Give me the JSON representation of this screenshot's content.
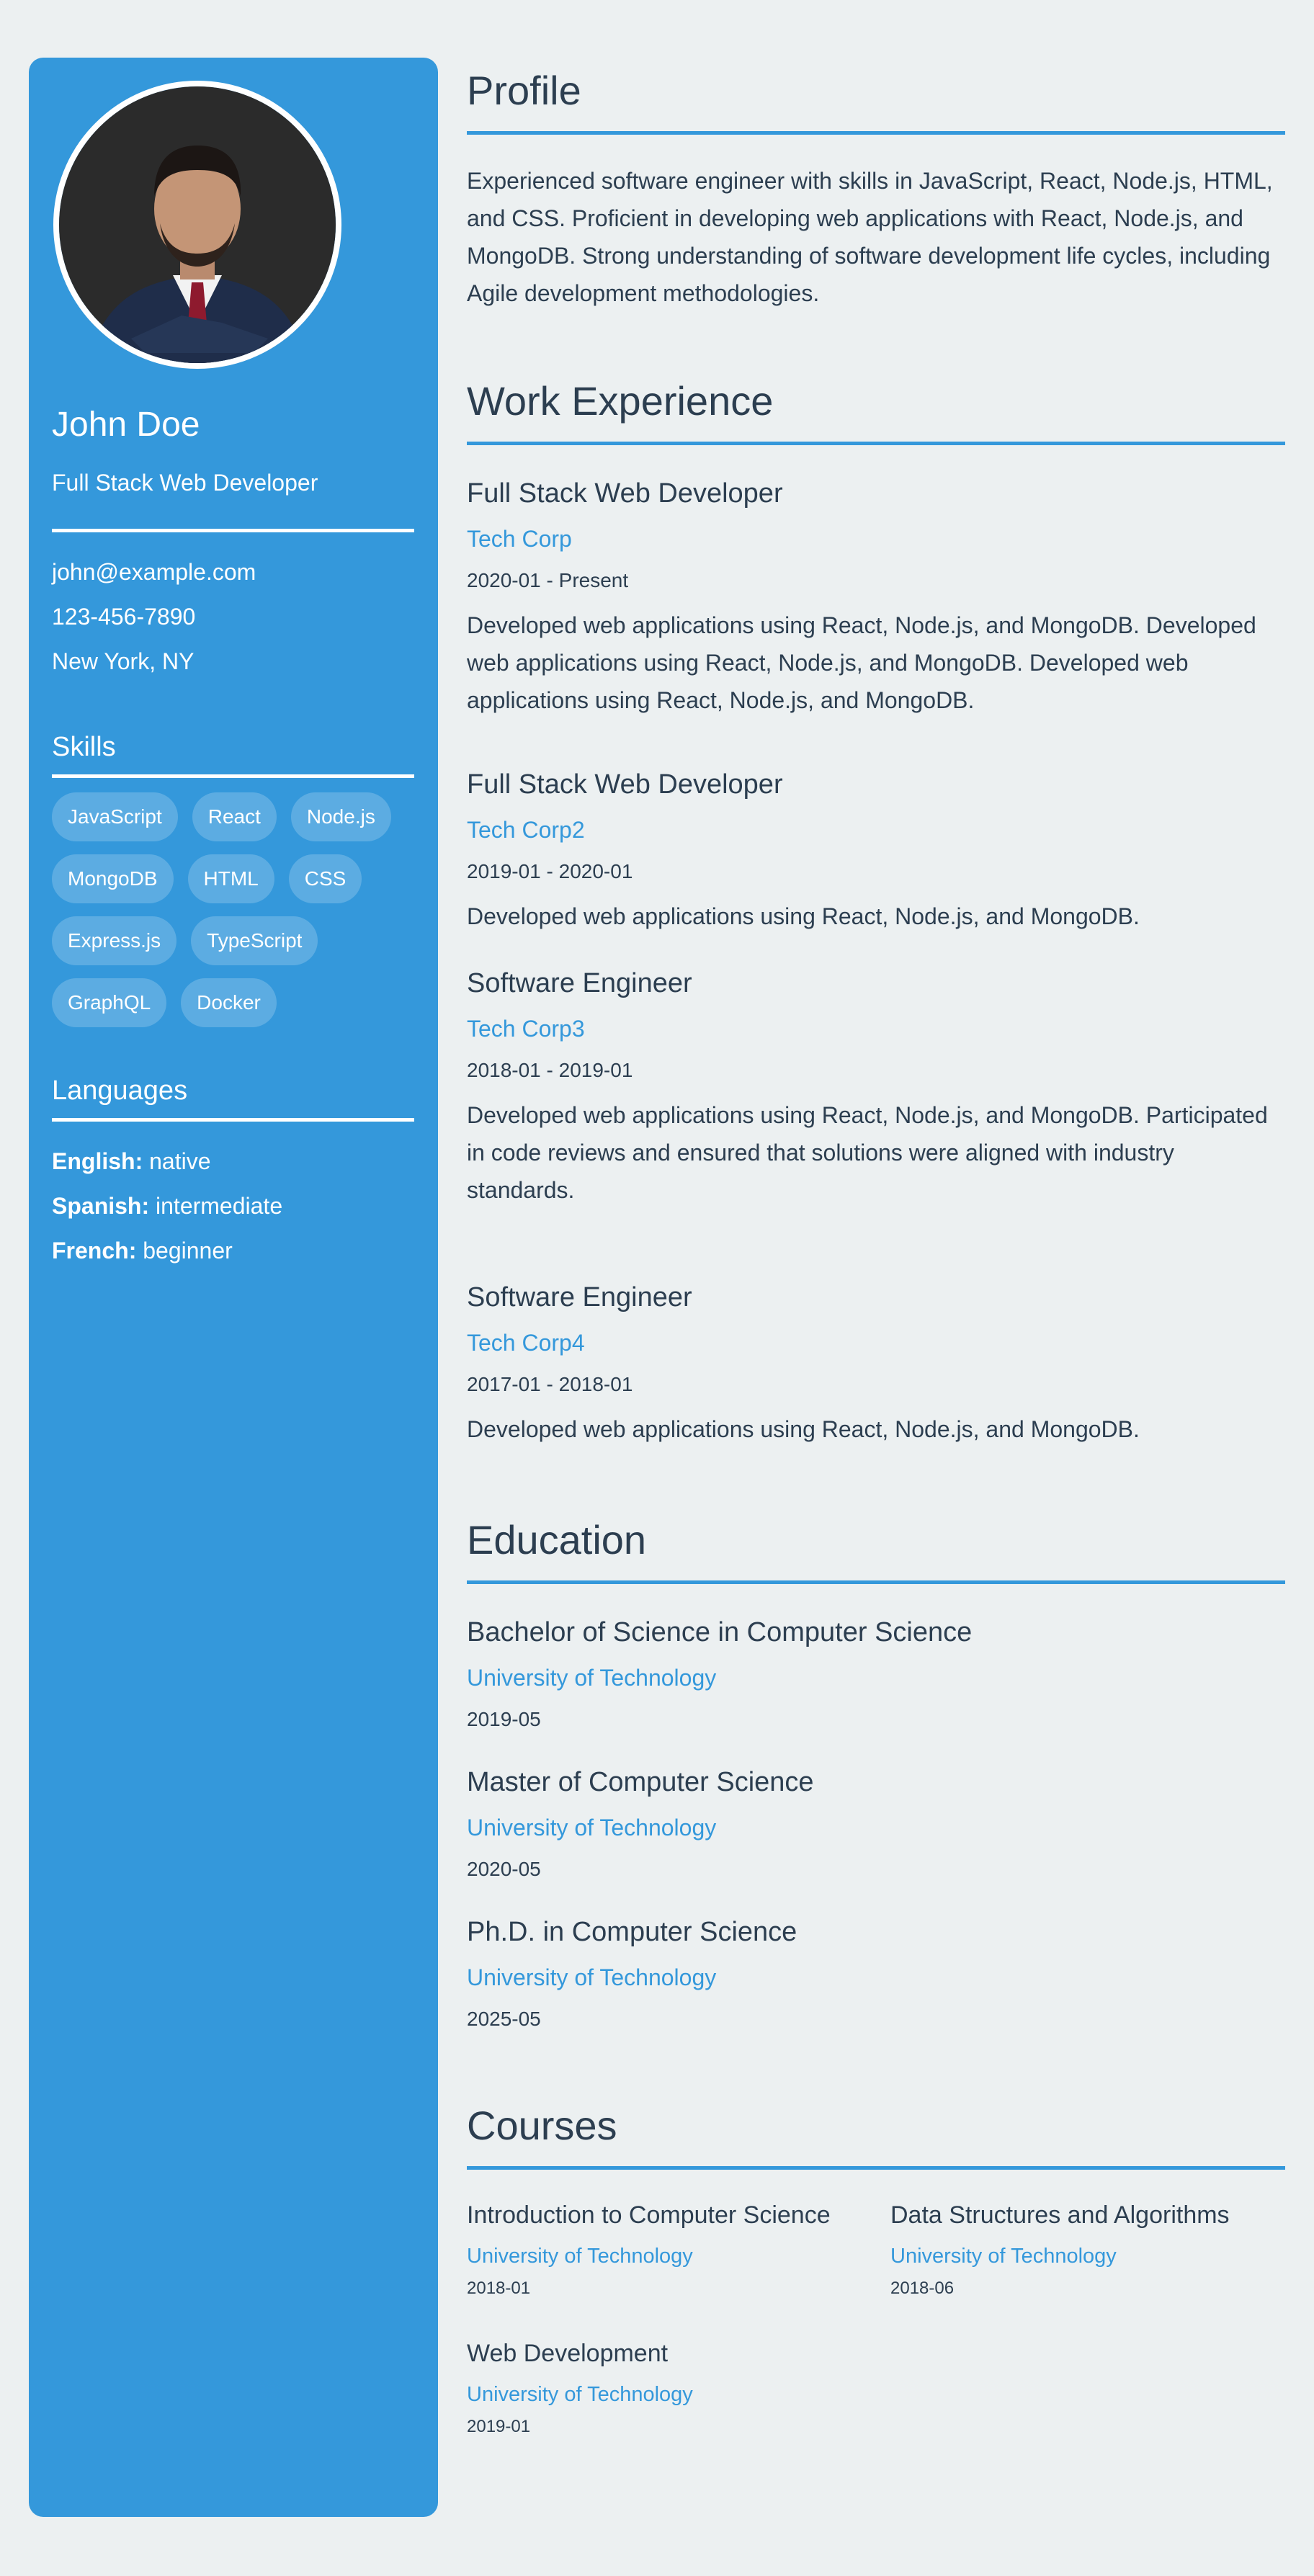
{
  "sidebar": {
    "name": "John Doe",
    "title": "Full Stack Web Developer",
    "contact": {
      "email": "john@example.com",
      "phone": "123-456-7890",
      "location": "New York, NY"
    },
    "skills_heading": "Skills",
    "skills": [
      "JavaScript",
      "React",
      "Node.js",
      "MongoDB",
      "HTML",
      "CSS",
      "Express.js",
      "TypeScript",
      "GraphQL",
      "Docker"
    ],
    "languages_heading": "Languages",
    "languages": [
      {
        "name": "English:",
        "level": "native"
      },
      {
        "name": "Spanish:",
        "level": "intermediate"
      },
      {
        "name": "French:",
        "level": "beginner"
      }
    ]
  },
  "profile": {
    "heading": "Profile",
    "text": "Experienced software engineer with skills in JavaScript, React, Node.js, HTML, and CSS. Proficient in developing web applications with React, Node.js, and MongoDB. Strong understanding of software development life cycles, including Agile development methodologies."
  },
  "work": {
    "heading": "Work Experience",
    "jobs": [
      {
        "title": "Full Stack Web Developer",
        "company": "Tech Corp",
        "dates": "2020-01 - Present",
        "description": "Developed web applications using React, Node.js, and MongoDB. Developed web applications using React, Node.js, and MongoDB. Developed web applications using React, Node.js, and MongoDB."
      },
      {
        "title": "Full Stack Web Developer",
        "company": "Tech Corp2",
        "dates": "2019-01 - 2020-01",
        "description": "Developed web applications using React, Node.js, and MongoDB."
      },
      {
        "title": "Software Engineer",
        "company": "Tech Corp3",
        "dates": "2018-01 - 2019-01",
        "description": "Developed web applications using React, Node.js, and MongoDB. Participated in code reviews and ensured that solutions were aligned with industry standards."
      },
      {
        "title": "Software Engineer",
        "company": "Tech Corp4",
        "dates": "2017-01 - 2018-01",
        "description": "Developed web applications using React, Node.js, and MongoDB."
      }
    ]
  },
  "education": {
    "heading": "Education",
    "items": [
      {
        "degree": "Bachelor of Science in Computer Science",
        "institution": "University of Technology",
        "date": "2019-05"
      },
      {
        "degree": "Master of Computer Science",
        "institution": "University of Technology",
        "date": "2020-05"
      },
      {
        "degree": "Ph.D. in Computer Science",
        "institution": "University of Technology",
        "date": "2025-05"
      }
    ]
  },
  "courses": {
    "heading": "Courses",
    "items": [
      {
        "title": "Introduction to Computer Science",
        "institution": "University of Technology",
        "date": "2018-01"
      },
      {
        "title": "Data Structures and Algorithms",
        "institution": "University of Technology",
        "date": "2018-06"
      },
      {
        "title": "Web Development",
        "institution": "University of Technology",
        "date": "2019-01"
      }
    ]
  },
  "colors": {
    "accent": "#3498db",
    "background": "#ecf0f1",
    "text": "#2c3e50"
  }
}
